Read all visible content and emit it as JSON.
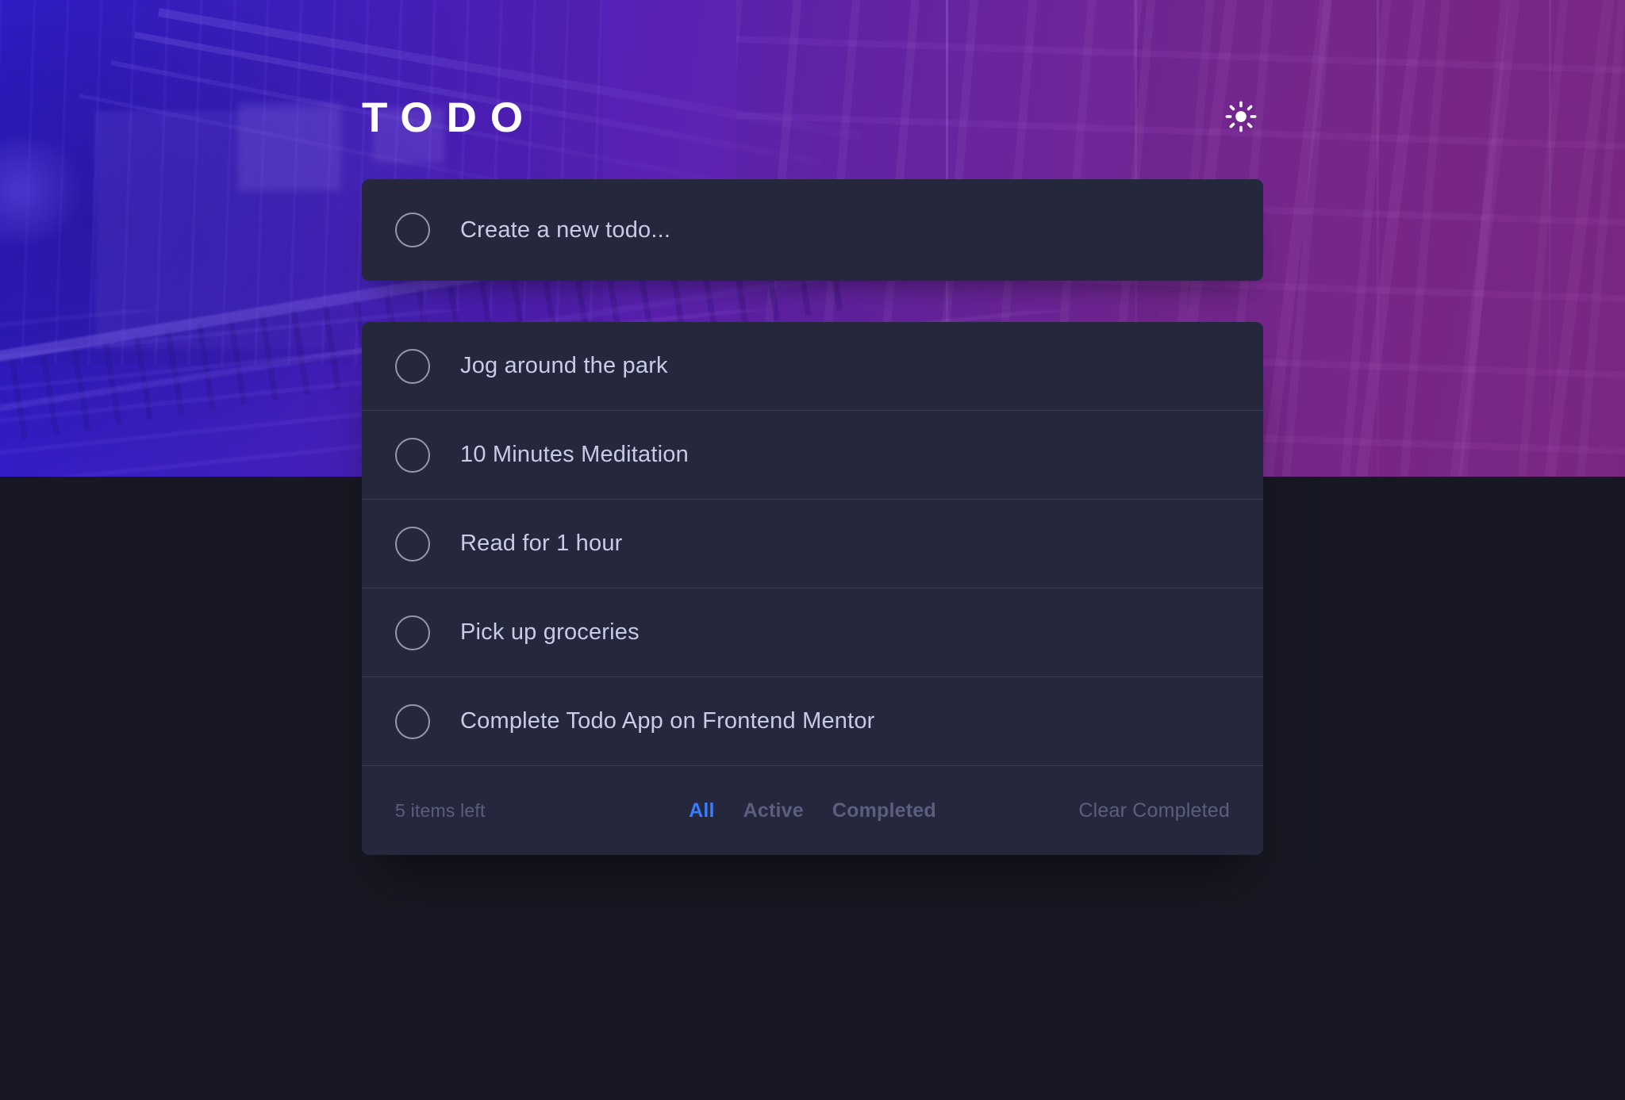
{
  "app": {
    "title": "TODO",
    "theme": "dark",
    "theme_toggle_icon": "sun-icon",
    "background_colors": {
      "page": "#171823",
      "card": "#25273c",
      "divider": "#393a4c",
      "text": "#c8cbe7",
      "muted_text": "#5b5e7e",
      "accent": "#3a7cfd",
      "hero_gradient_start": "#2b1ec8",
      "hero_gradient_end": "#7d2a84",
      "circle_border": "#9698a6"
    }
  },
  "new_todo": {
    "placeholder": "Create a new todo...",
    "value": "",
    "checkbox_icon": "circle-icon"
  },
  "todos": [
    {
      "label": "Jog around the park",
      "completed": false
    },
    {
      "label": "10 Minutes Meditation",
      "completed": false
    },
    {
      "label": "Read for 1 hour",
      "completed": false
    },
    {
      "label": "Pick up groceries",
      "completed": false
    },
    {
      "label": "Complete Todo App on Frontend Mentor",
      "completed": false
    }
  ],
  "footer": {
    "items_left": "5 items left",
    "filters": [
      {
        "label": "All",
        "active": true
      },
      {
        "label": "Active",
        "active": false
      },
      {
        "label": "Completed",
        "active": false
      }
    ],
    "clear_completed": "Clear Completed"
  }
}
